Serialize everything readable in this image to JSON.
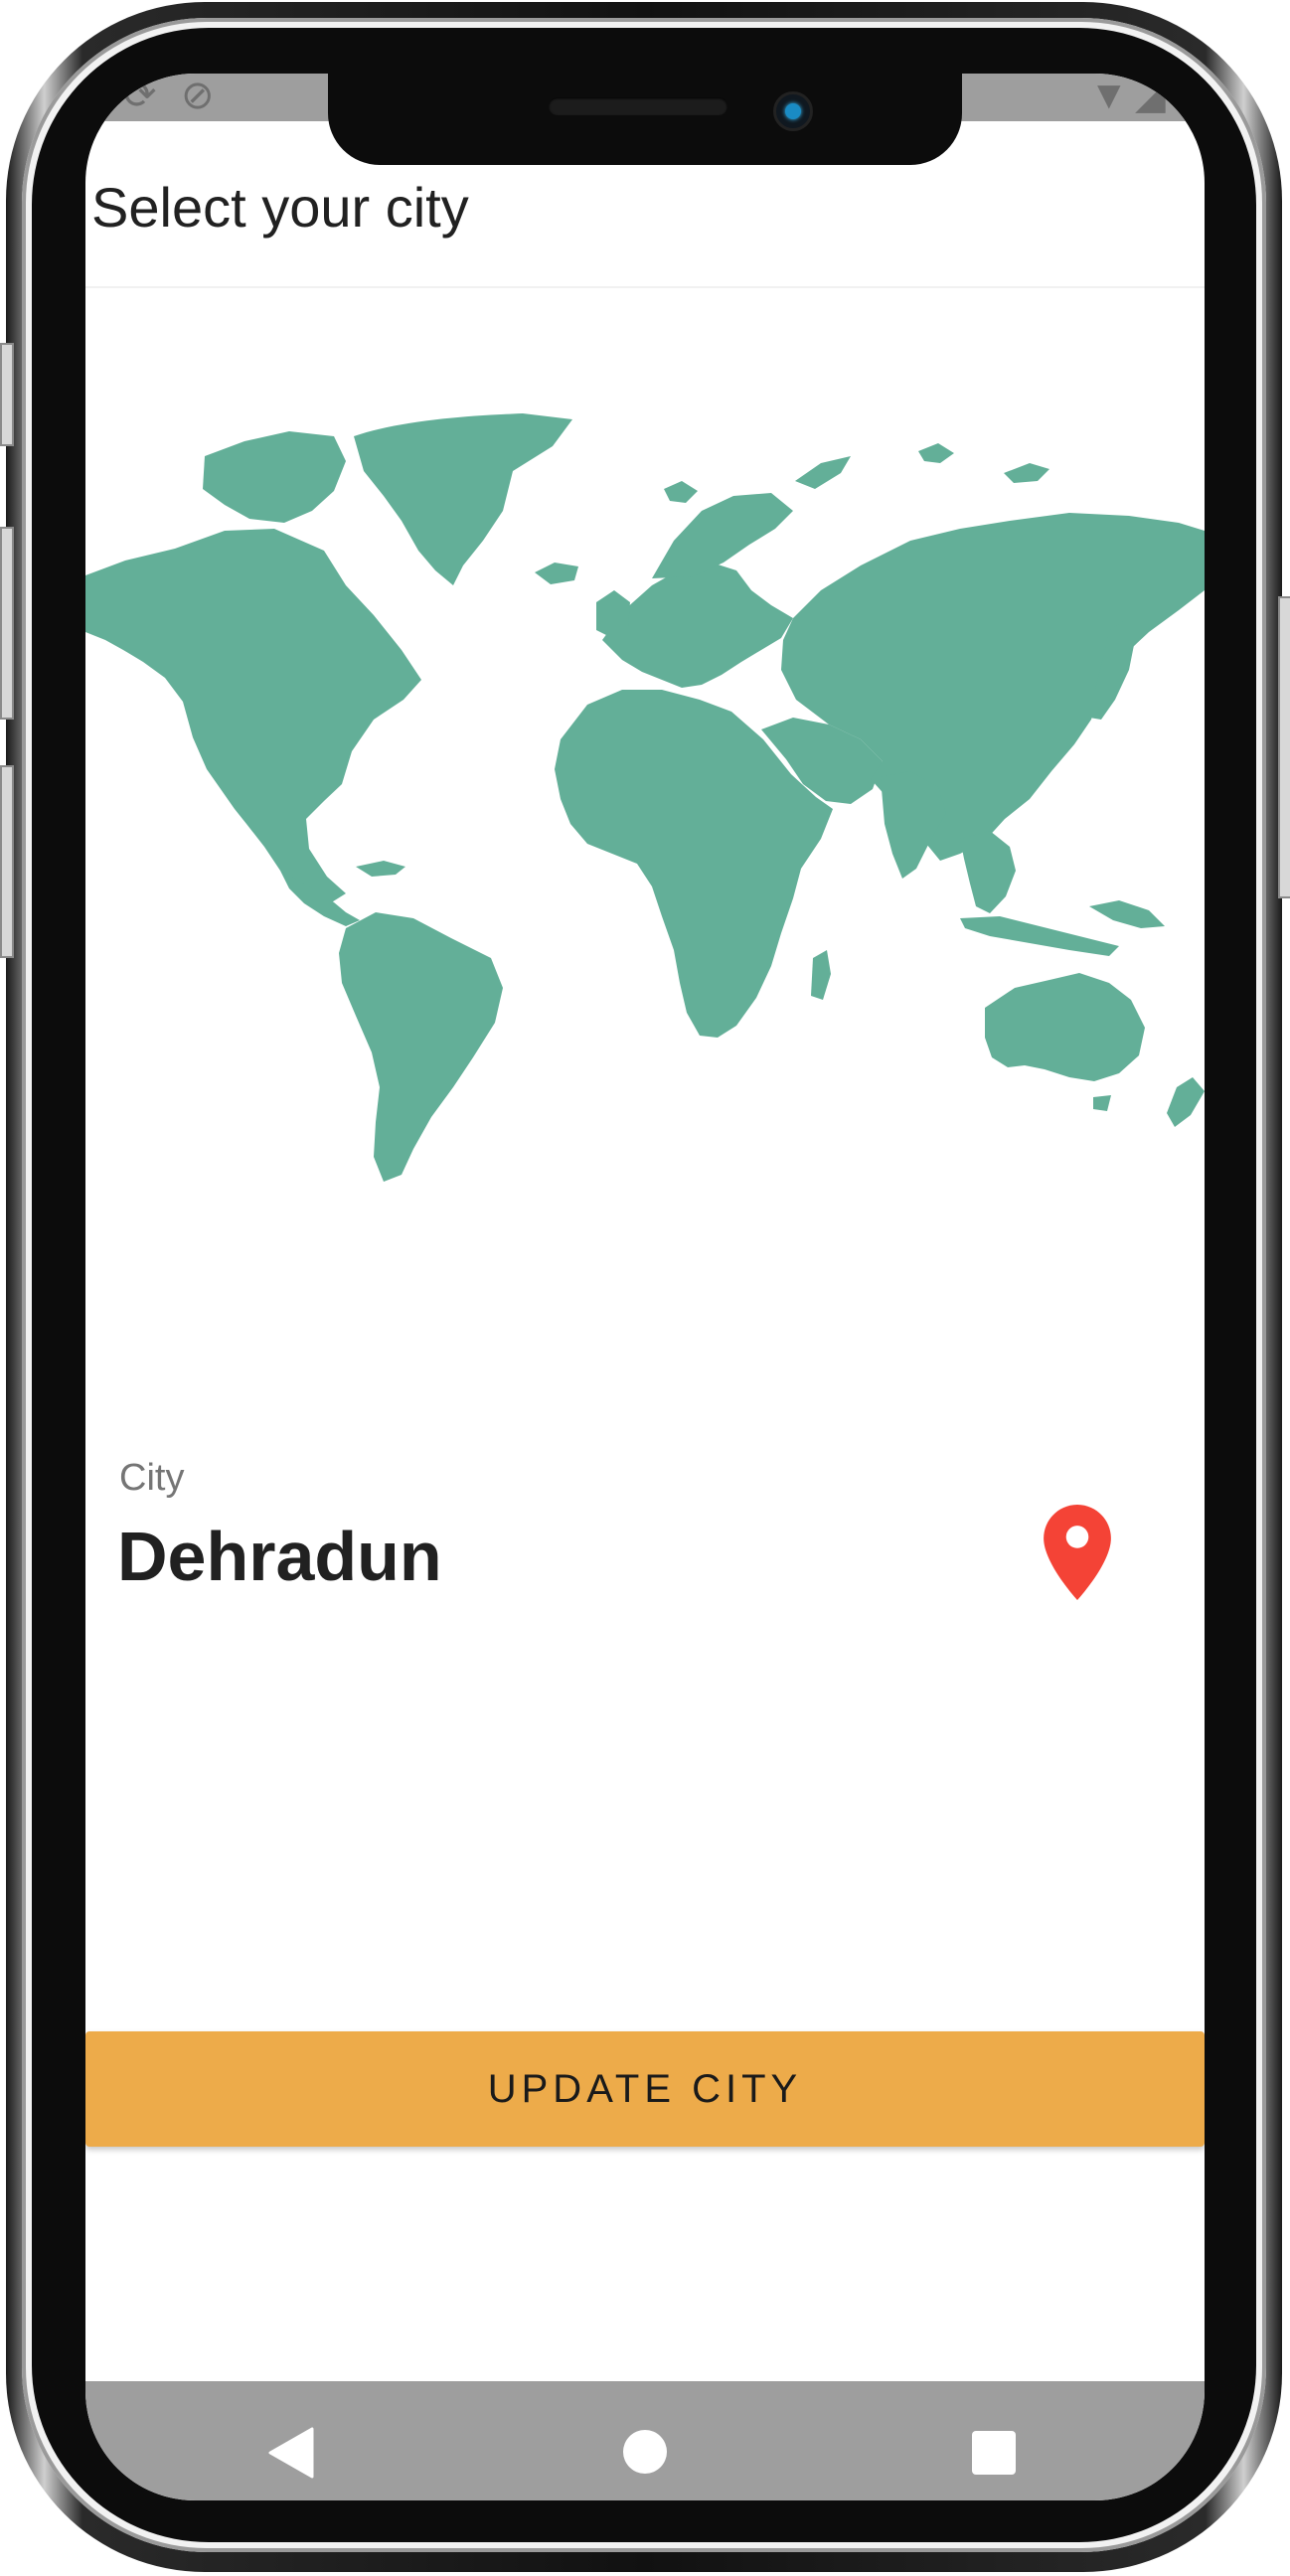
{
  "app_bar": {
    "title": "Select your city"
  },
  "map": {
    "land_color": "#63af98"
  },
  "city": {
    "label": "City",
    "value": "Dehradun",
    "pin_icon": "map-pin-icon",
    "pin_color": "#f44336"
  },
  "actions": {
    "update_label": "UPDATE CITY",
    "update_color": "#edab4a"
  },
  "status_bar": {
    "icons": [
      "sync-icon",
      "do-not-disturb-icon",
      "wifi-icon",
      "signal-icon"
    ]
  },
  "nav_bar": {
    "icons": [
      "back-triangle-icon",
      "home-circle-icon",
      "recents-square-icon"
    ]
  }
}
